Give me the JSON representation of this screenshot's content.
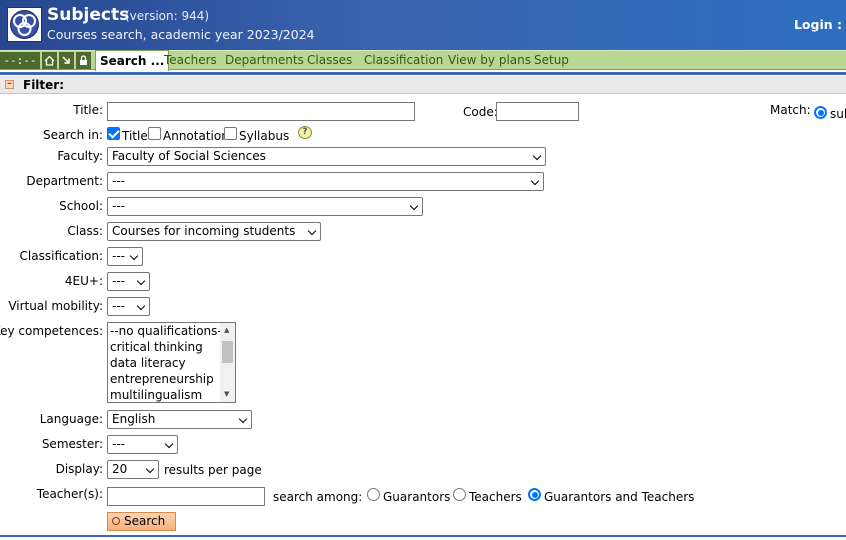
{
  "header": {
    "title": "Subjects",
    "version": "(version: 944)",
    "subtitle": "Courses search, academic year 2023/2024",
    "login": "Login :"
  },
  "nav": {
    "clock": "--:--",
    "icons": [
      "home-icon",
      "enter-icon",
      "lock-icon"
    ],
    "active_tab": "Search ...",
    "tabs": [
      "Teachers",
      "Departments",
      "Classes",
      "Classification",
      "View by plans",
      "Setup"
    ]
  },
  "filter": {
    "header": "Filter:",
    "title_label": "Title:",
    "title_value": "",
    "code_label": "Code:",
    "code_value": "",
    "match_label": "Match:",
    "match_option": "sul",
    "search_in_label": "Search in:",
    "search_in": [
      {
        "label": "Title",
        "checked": true
      },
      {
        "label": "Annotation",
        "checked": false
      },
      {
        "label": "Syllabus",
        "checked": false
      }
    ],
    "faculty_label": "Faculty:",
    "faculty_value": "Faculty of Social Sciences",
    "department_label": "Department:",
    "department_value": "---",
    "school_label": "School:",
    "school_value": "---",
    "class_label": "Class:",
    "class_value": "Courses for incoming students",
    "classification_label": "Classification:",
    "classification_value": "---",
    "fourEU_label": "4EU+:",
    "fourEU_value": "---",
    "virtual_label": "Virtual mobility:",
    "virtual_value": "---",
    "competences_label": "Key competences:",
    "competences": [
      "--no qualifications--",
      "critical thinking",
      "data literacy",
      "entrepreneurship",
      "multilingualism"
    ],
    "language_label": "Language:",
    "language_value": "English",
    "semester_label": "Semester:",
    "semester_value": "---",
    "display_label": "Display:",
    "display_value": "20",
    "display_suffix": "results per page",
    "teachers_label": "Teacher(s):",
    "teachers_value": "",
    "search_among_label": "search among:",
    "search_among": [
      {
        "label": "Guarantors",
        "selected": false
      },
      {
        "label": "Teachers",
        "selected": false
      },
      {
        "label": "Guarantors and Teachers",
        "selected": true
      }
    ],
    "search_button": "Search"
  }
}
